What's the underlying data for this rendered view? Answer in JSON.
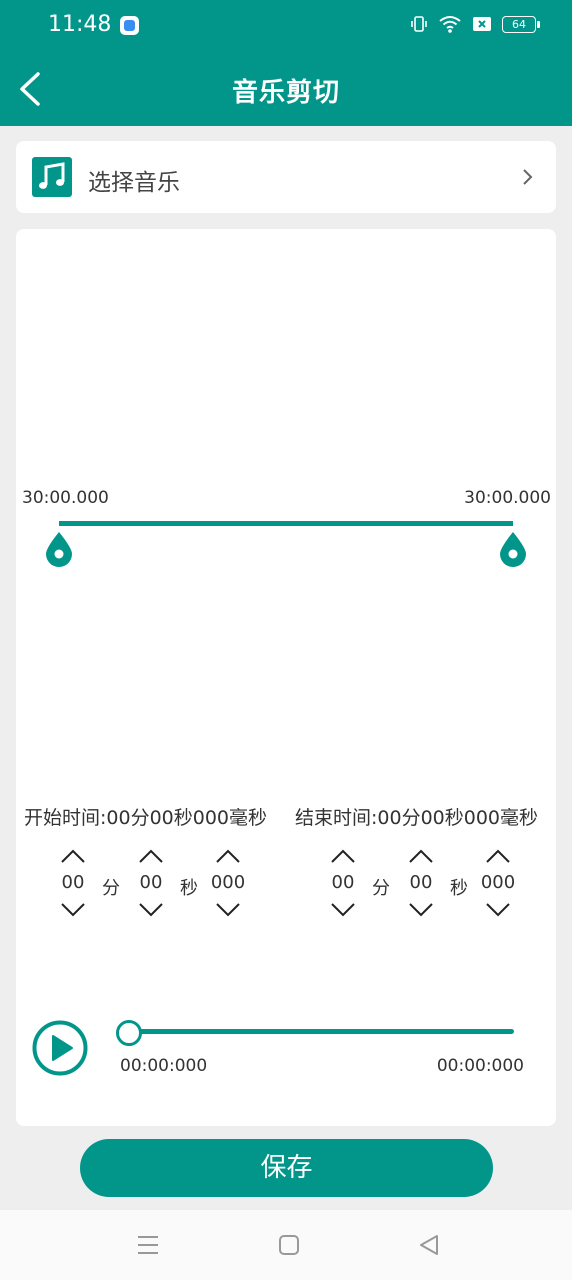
{
  "status_bar": {
    "time": "11:48",
    "battery": "64",
    "icons": [
      "app-notification-icon",
      "vibrate-icon",
      "wifi-icon",
      "sim-off-icon",
      "battery-icon"
    ]
  },
  "app_bar": {
    "title": "音乐剪切",
    "back_icon": "chevron-left-icon"
  },
  "select_music": {
    "label": "选择音乐",
    "icon": "music-note-icon",
    "chevron": "chevron-right-icon"
  },
  "range": {
    "start_label": "30:00.000",
    "end_label": "30:00.000"
  },
  "start_time": {
    "summary": "开始时间:00分00秒000毫秒",
    "minutes": "00",
    "minutes_unit": "分",
    "seconds": "00",
    "seconds_unit": "秒",
    "millis": "000"
  },
  "end_time": {
    "summary": "结束时间:00分00秒000毫秒",
    "minutes": "00",
    "minutes_unit": "分",
    "seconds": "00",
    "seconds_unit": "秒",
    "millis": "000"
  },
  "player": {
    "current": "00:00:000",
    "total": "00:00:000",
    "progress": 0
  },
  "save_label": "保存",
  "nav_bar": {
    "icons": [
      "menu-icon",
      "home-icon",
      "back-triangle-icon"
    ]
  },
  "colors": {
    "accent": "#02968a",
    "background": "#eeeeee",
    "card": "#ffffff"
  }
}
